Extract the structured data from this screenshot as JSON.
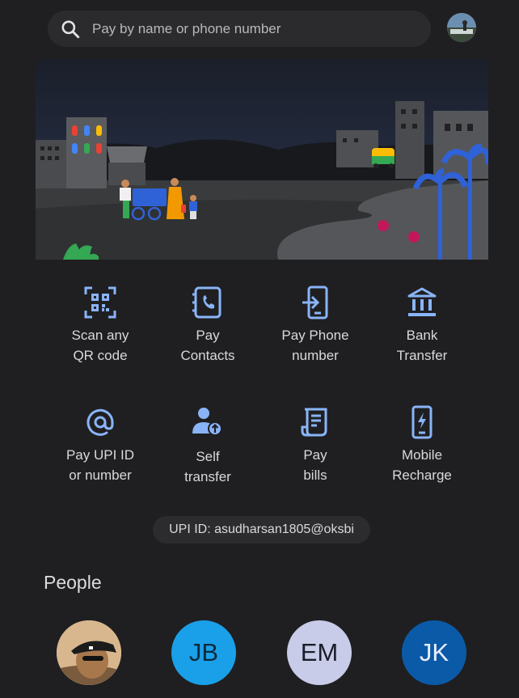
{
  "search": {
    "placeholder": "Pay by name or phone number",
    "icon": "search-icon"
  },
  "account": {
    "icon": "account-avatar"
  },
  "actions": [
    {
      "label_line1": "Scan any",
      "label_line2": "QR code",
      "icon": "qr-scan-icon"
    },
    {
      "label_line1": "Pay",
      "label_line2": "Contacts",
      "icon": "contacts-icon"
    },
    {
      "label_line1": "Pay Phone",
      "label_line2": "number",
      "icon": "phone-pay-icon"
    },
    {
      "label_line1": "Bank",
      "label_line2": "Transfer",
      "icon": "bank-icon"
    },
    {
      "label_line1": "Pay UPI ID",
      "label_line2": "or number",
      "icon": "at-icon"
    },
    {
      "label_line1": "Self",
      "label_line2": "transfer",
      "icon": "self-transfer-icon"
    },
    {
      "label_line1": "Pay",
      "label_line2": "bills",
      "icon": "bill-icon"
    },
    {
      "label_line1": "Mobile",
      "label_line2": "Recharge",
      "icon": "mobile-recharge-icon"
    }
  ],
  "upi_id": "UPI ID: asudharsan1805@oksbi",
  "people": {
    "title": "People",
    "contacts": [
      {
        "initials": "",
        "type": "photo",
        "color": "#e8c7a0"
      },
      {
        "initials": "JB",
        "type": "initials",
        "color": "#1aa0e8",
        "text_color": "#0d2a3f"
      },
      {
        "initials": "EM",
        "type": "initials",
        "color": "#c9cce8",
        "text_color": "#1b1d2c"
      },
      {
        "initials": "JK",
        "type": "initials",
        "color": "#0b5aa8",
        "text_color": "#e8eefa"
      }
    ]
  },
  "colors": {
    "accent": "#8ab4f8",
    "background": "#1f1f22",
    "surface": "#2b2b2e"
  }
}
